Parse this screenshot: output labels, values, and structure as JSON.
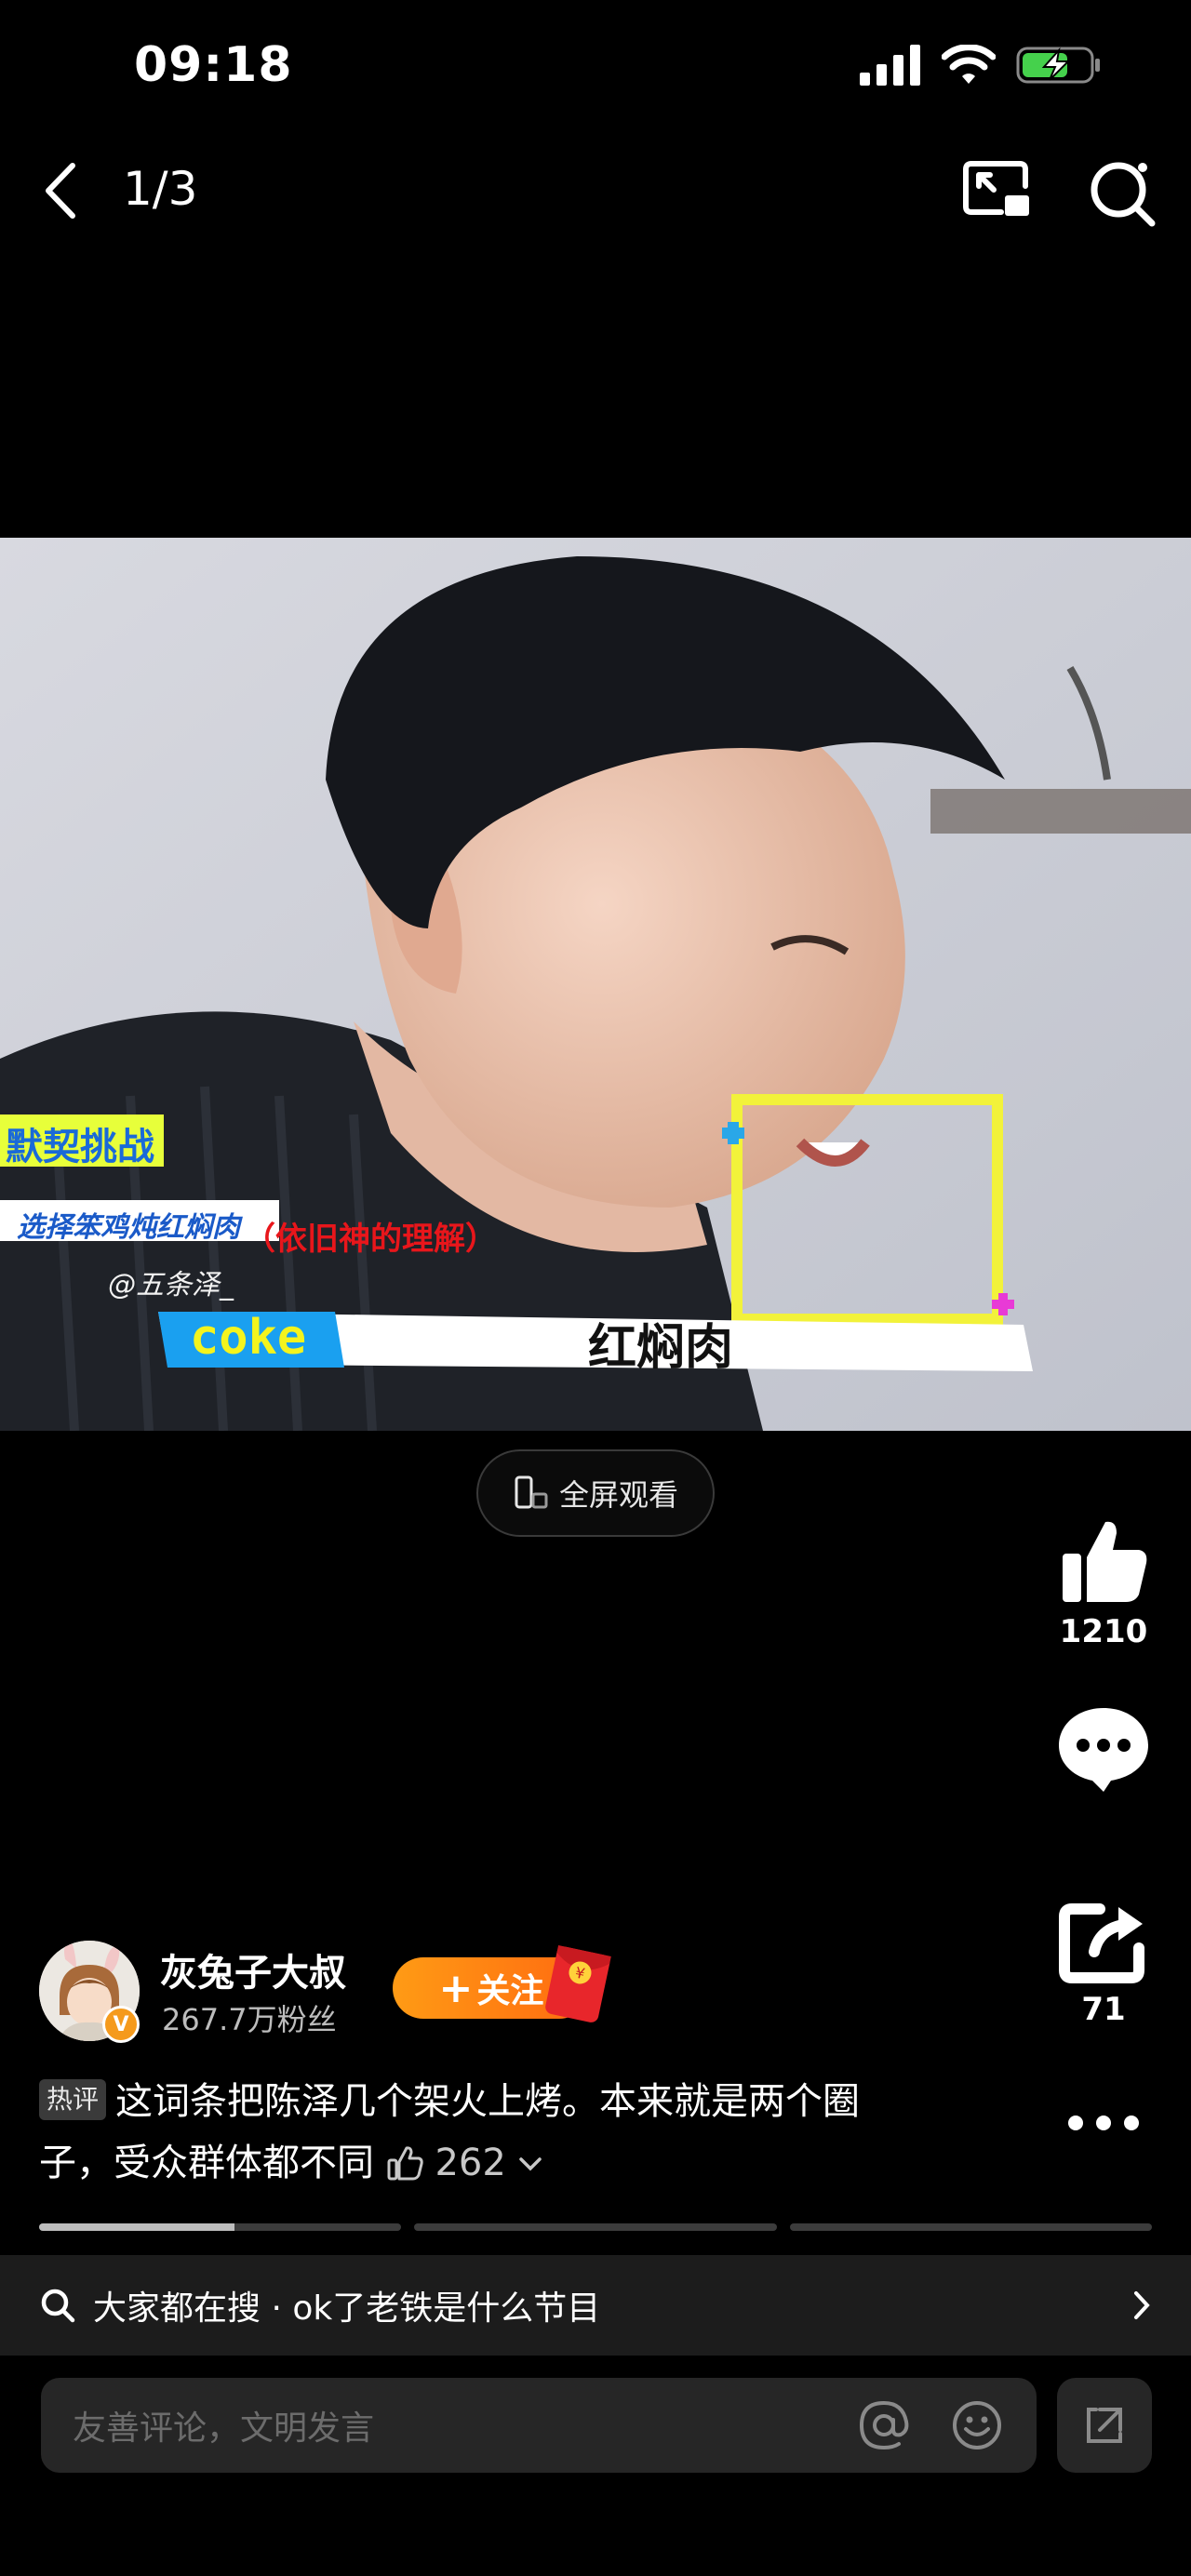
{
  "status_bar": {
    "time": "09:18"
  },
  "nav": {
    "page_counter": "1/3"
  },
  "video": {
    "overlay": {
      "challenge_label": "默契挑战",
      "choice_label": "选择笨鸡炖红焖肉",
      "red_caption": "（依旧神的理解）",
      "watermark": "@五条泽_",
      "name_tag": "coke",
      "answer_text": "红焖肉"
    },
    "fullscreen_label": "全屏观看"
  },
  "actions": {
    "like_count": "1210",
    "share_count": "71"
  },
  "author": {
    "name": "灰兔子大叔",
    "fans": "267.7万粉丝",
    "follow_label": "关注"
  },
  "caption": {
    "tag": "热评",
    "text": "这词条把陈泽几个架火上烤。本来就是两个圈子，受众群体都不同",
    "like_count": "262"
  },
  "progress": {
    "segments": [
      0.54,
      0,
      0
    ]
  },
  "search_suggestion": {
    "text": "大家都在搜 · ok了老铁是什么节目"
  },
  "comment": {
    "placeholder": "友善评论，文明发言"
  },
  "colors": {
    "accent_orange": "#ff8a12",
    "background": "#000000"
  }
}
